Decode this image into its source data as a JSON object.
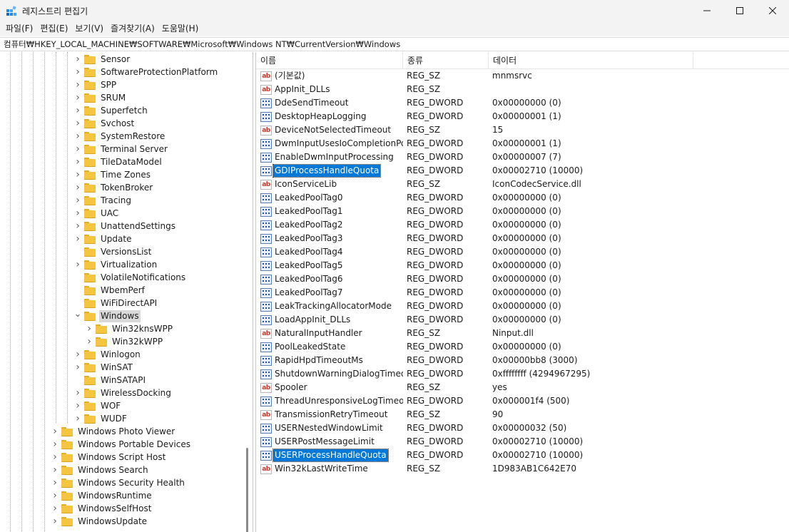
{
  "window": {
    "title": "레지스트리 편집기",
    "minimize": "—",
    "maximize": "☐",
    "close": "✕"
  },
  "menu": [
    "파일(F)",
    "편집(E)",
    "보기(V)",
    "즐겨찾기(A)",
    "도움말(H)"
  ],
  "address": "컴퓨터₩HKEY_LOCAL_MACHINE₩SOFTWARE₩Microsoft₩Windows NT₩CurrentVersion₩Windows",
  "tree": [
    {
      "label": "Sensor",
      "level": 2,
      "expander": "collapsed"
    },
    {
      "label": "SoftwareProtectionPlatform",
      "level": 2,
      "expander": "collapsed"
    },
    {
      "label": "SPP",
      "level": 2,
      "expander": "collapsed"
    },
    {
      "label": "SRUM",
      "level": 2,
      "expander": "collapsed"
    },
    {
      "label": "Superfetch",
      "level": 2,
      "expander": "collapsed"
    },
    {
      "label": "Svchost",
      "level": 2,
      "expander": "collapsed"
    },
    {
      "label": "SystemRestore",
      "level": 2,
      "expander": "collapsed"
    },
    {
      "label": "Terminal Server",
      "level": 2,
      "expander": "collapsed"
    },
    {
      "label": "TileDataModel",
      "level": 2,
      "expander": "collapsed"
    },
    {
      "label": "Time Zones",
      "level": 2,
      "expander": "collapsed"
    },
    {
      "label": "TokenBroker",
      "level": 2,
      "expander": "collapsed"
    },
    {
      "label": "Tracing",
      "level": 2,
      "expander": "collapsed"
    },
    {
      "label": "UAC",
      "level": 2,
      "expander": "collapsed"
    },
    {
      "label": "UnattendSettings",
      "level": 2,
      "expander": "collapsed"
    },
    {
      "label": "Update",
      "level": 2,
      "expander": "collapsed"
    },
    {
      "label": "VersionsList",
      "level": 2,
      "expander": "none"
    },
    {
      "label": "Virtualization",
      "level": 2,
      "expander": "collapsed"
    },
    {
      "label": "VolatileNotifications",
      "level": 2,
      "expander": "none"
    },
    {
      "label": "WbemPerf",
      "level": 2,
      "expander": "none"
    },
    {
      "label": "WiFiDirectAPI",
      "level": 2,
      "expander": "none"
    },
    {
      "label": "Windows",
      "level": 2,
      "expander": "expanded",
      "selected": true
    },
    {
      "label": "Win32knsWPP",
      "level": 3,
      "expander": "collapsed"
    },
    {
      "label": "Win32kWPP",
      "level": 3,
      "expander": "collapsed"
    },
    {
      "label": "Winlogon",
      "level": 2,
      "expander": "collapsed"
    },
    {
      "label": "WinSAT",
      "level": 2,
      "expander": "collapsed"
    },
    {
      "label": "WinSATAPI",
      "level": 2,
      "expander": "none"
    },
    {
      "label": "WirelessDocking",
      "level": 2,
      "expander": "collapsed"
    },
    {
      "label": "WOF",
      "level": 2,
      "expander": "collapsed"
    },
    {
      "label": "WUDF",
      "level": 2,
      "expander": "collapsed"
    },
    {
      "label": "Windows Photo Viewer",
      "level": 1,
      "expander": "collapsed"
    },
    {
      "label": "Windows Portable Devices",
      "level": 1,
      "expander": "collapsed"
    },
    {
      "label": "Windows Script Host",
      "level": 1,
      "expander": "collapsed"
    },
    {
      "label": "Windows Search",
      "level": 1,
      "expander": "collapsed"
    },
    {
      "label": "Windows Security Health",
      "level": 1,
      "expander": "collapsed"
    },
    {
      "label": "WindowsRuntime",
      "level": 1,
      "expander": "collapsed"
    },
    {
      "label": "WindowsSelfHost",
      "level": 1,
      "expander": "collapsed"
    },
    {
      "label": "WindowsUpdate",
      "level": 1,
      "expander": "collapsed"
    }
  ],
  "columns": {
    "name": "이름",
    "type": "종류",
    "data": "데이터"
  },
  "values": [
    {
      "name": "(기본값)",
      "type": "REG_SZ",
      "data": "mnmsrvc",
      "icon": "string-value-icon"
    },
    {
      "name": "AppInit_DLLs",
      "type": "REG_SZ",
      "data": "",
      "icon": "string-value-icon"
    },
    {
      "name": "DdeSendTimeout",
      "type": "REG_DWORD",
      "data": "0x00000000 (0)",
      "icon": "dword-value-icon"
    },
    {
      "name": "DesktopHeapLogging",
      "type": "REG_DWORD",
      "data": "0x00000001 (1)",
      "icon": "dword-value-icon"
    },
    {
      "name": "DeviceNotSelectedTimeout",
      "type": "REG_SZ",
      "data": "15",
      "icon": "string-value-icon"
    },
    {
      "name": "DwmInputUsesIoCompletionPort",
      "type": "REG_DWORD",
      "data": "0x00000001 (1)",
      "icon": "dword-value-icon"
    },
    {
      "name": "EnableDwmInputProcessing",
      "type": "REG_DWORD",
      "data": "0x00000007 (7)",
      "icon": "dword-value-icon"
    },
    {
      "name": "GDIProcessHandleQuota",
      "type": "REG_DWORD",
      "data": "0x00002710 (10000)",
      "icon": "dword-value-icon",
      "selected": true
    },
    {
      "name": "IconServiceLib",
      "type": "REG_SZ",
      "data": "IconCodecService.dll",
      "icon": "string-value-icon"
    },
    {
      "name": "LeakedPoolTag0",
      "type": "REG_DWORD",
      "data": "0x00000000 (0)",
      "icon": "dword-value-icon"
    },
    {
      "name": "LeakedPoolTag1",
      "type": "REG_DWORD",
      "data": "0x00000000 (0)",
      "icon": "dword-value-icon"
    },
    {
      "name": "LeakedPoolTag2",
      "type": "REG_DWORD",
      "data": "0x00000000 (0)",
      "icon": "dword-value-icon"
    },
    {
      "name": "LeakedPoolTag3",
      "type": "REG_DWORD",
      "data": "0x00000000 (0)",
      "icon": "dword-value-icon"
    },
    {
      "name": "LeakedPoolTag4",
      "type": "REG_DWORD",
      "data": "0x00000000 (0)",
      "icon": "dword-value-icon"
    },
    {
      "name": "LeakedPoolTag5",
      "type": "REG_DWORD",
      "data": "0x00000000 (0)",
      "icon": "dword-value-icon"
    },
    {
      "name": "LeakedPoolTag6",
      "type": "REG_DWORD",
      "data": "0x00000000 (0)",
      "icon": "dword-value-icon"
    },
    {
      "name": "LeakedPoolTag7",
      "type": "REG_DWORD",
      "data": "0x00000000 (0)",
      "icon": "dword-value-icon"
    },
    {
      "name": "LeakTrackingAllocatorMode",
      "type": "REG_DWORD",
      "data": "0x00000000 (0)",
      "icon": "dword-value-icon"
    },
    {
      "name": "LoadAppInit_DLLs",
      "type": "REG_DWORD",
      "data": "0x00000000 (0)",
      "icon": "dword-value-icon"
    },
    {
      "name": "NaturalInputHandler",
      "type": "REG_SZ",
      "data": "Ninput.dll",
      "icon": "string-value-icon"
    },
    {
      "name": "PoolLeakedState",
      "type": "REG_DWORD",
      "data": "0x00000000 (0)",
      "icon": "dword-value-icon"
    },
    {
      "name": "RapidHpdTimeoutMs",
      "type": "REG_DWORD",
      "data": "0x00000bb8 (3000)",
      "icon": "dword-value-icon"
    },
    {
      "name": "ShutdownWarningDialogTimeout",
      "type": "REG_DWORD",
      "data": "0xffffffff (4294967295)",
      "icon": "dword-value-icon"
    },
    {
      "name": "Spooler",
      "type": "REG_SZ",
      "data": "yes",
      "icon": "string-value-icon"
    },
    {
      "name": "ThreadUnresponsiveLogTimeout",
      "type": "REG_DWORD",
      "data": "0x000001f4 (500)",
      "icon": "dword-value-icon"
    },
    {
      "name": "TransmissionRetryTimeout",
      "type": "REG_SZ",
      "data": "90",
      "icon": "string-value-icon"
    },
    {
      "name": "USERNestedWindowLimit",
      "type": "REG_DWORD",
      "data": "0x00000032 (50)",
      "icon": "dword-value-icon"
    },
    {
      "name": "USERPostMessageLimit",
      "type": "REG_DWORD",
      "data": "0x00002710 (10000)",
      "icon": "dword-value-icon"
    },
    {
      "name": "USERProcessHandleQuota",
      "type": "REG_DWORD",
      "data": "0x00002710 (10000)",
      "icon": "dword-value-icon",
      "selected": true
    },
    {
      "name": "Win32kLastWriteTime",
      "type": "REG_SZ",
      "data": "1D983AB1C642E70",
      "icon": "string-value-icon"
    }
  ],
  "string_icon_text": "ab",
  "colors": {
    "selection": "#0078d7",
    "tree_selection": "#d9d9d9",
    "folder": "#f5c542"
  }
}
